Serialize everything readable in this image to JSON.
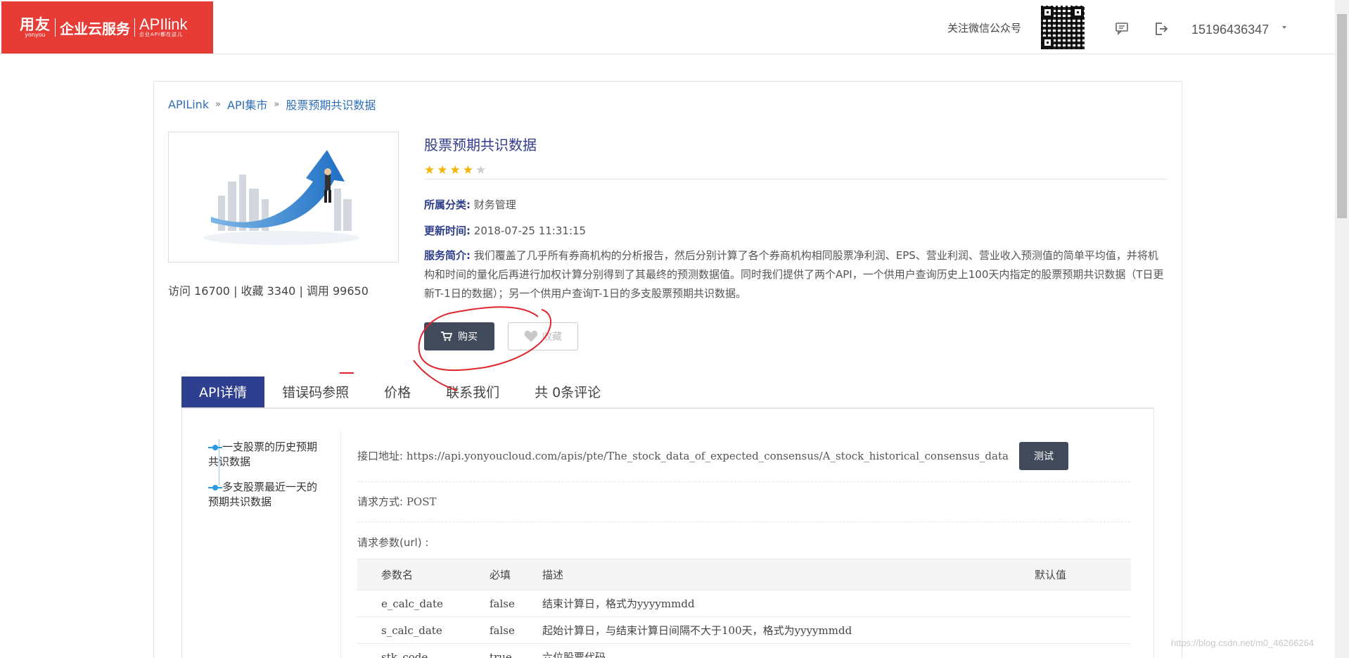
{
  "header": {
    "logo_brand": "用友",
    "logo_brand_en": "yonyou",
    "logo_service": "企业云服务",
    "logo_product": "APIlink",
    "logo_slogan": "企业API都在这儿",
    "follow_text": "关注微信公众号",
    "user_phone": "15196436347",
    "icons": [
      "message-icon",
      "logout-icon",
      "dropdown-caret-icon"
    ]
  },
  "breadcrumb": [
    "APILink",
    "API集市",
    "股票预期共识数据"
  ],
  "product": {
    "title": "股票预期共识数据",
    "rating": 4,
    "rating_max": 5,
    "stats": "访问 16700 | 收藏 3340 | 调用 99650",
    "category_label": "所属分类:",
    "category_value": "财务管理",
    "updated_label": "更新时间:",
    "updated_value": "2018-07-25 11:31:15",
    "intro_label": "服务简介:",
    "intro_text": "我们覆盖了几乎所有券商机构的分析报告，然后分别计算了各个券商机构相同股票净利润、EPS、营业利润、营业收入预测值的简单平均值，并将机构和时间的量化后再进行加权计算分别得到了其最终的预测数据值。同时我们提供了两个API，一个供用户查询历史上100天内指定的股票预期共识数据（T日更新T-1日的数据）；另一个供用户查询T-1日的多支股票预期共识数据。",
    "buy_label": "购买",
    "fav_label": "收藏"
  },
  "tabs": [
    {
      "label": "API详情",
      "active": true
    },
    {
      "label": "错误码参照",
      "active": false
    },
    {
      "label": "价格",
      "active": false
    },
    {
      "label": "联系我们",
      "active": false
    },
    {
      "label": "共 0条评论",
      "active": false
    }
  ],
  "side_nav": [
    "一支股票的历史预期共识数据",
    "多支股票最近一天的预期共识数据"
  ],
  "api": {
    "url_label": "接口地址:",
    "url_value": "https://api.yonyoucloud.com/apis/pte/The_stock_data_of_expected_consensus/A_stock_historical_consensus_data",
    "test_label": "测试",
    "method_label": "请求方式:",
    "method_value": "POST",
    "params_label": "请求参数(url) :",
    "param_headers": [
      "参数名",
      "必填",
      "描述",
      "默认值"
    ],
    "params": [
      [
        "e_calc_date",
        "false",
        "结束计算日，格式为yyyymmdd",
        ""
      ],
      [
        "s_calc_date",
        "false",
        "起始计算日，与结束计算日间隔不大于100天，格式为yyyymmdd",
        ""
      ],
      [
        "stk_code",
        "true",
        "六位股票代码",
        ""
      ]
    ]
  },
  "watermark": "https://blog.csdn.net/m0_46266264",
  "colors": {
    "logo_red": "#e63c35",
    "tab_active": "#2f3f8f",
    "button_dark": "#414a5b",
    "star": "#f5b400",
    "annotation_red": "#e0242b"
  }
}
